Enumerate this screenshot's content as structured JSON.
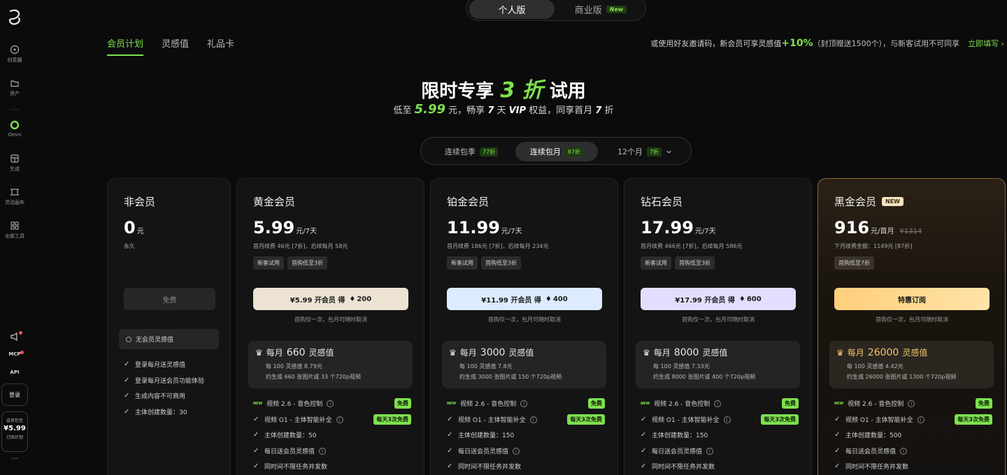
{
  "sidebar": {
    "items": [
      {
        "label": "创意圈",
        "icon": "compass-icon"
      },
      {
        "label": "资产",
        "icon": "folder-icon"
      },
      {
        "label": "Omni",
        "icon": "omni-icon"
      },
      {
        "label": "生成",
        "icon": "generate-icon"
      },
      {
        "label": "灵动画布",
        "icon": "canvas-icon"
      },
      {
        "label": "全部工具",
        "icon": "grid-icon"
      }
    ],
    "mcp": "MCP",
    "api": "API",
    "login": "登录",
    "promo": {
      "line1": "会员包至",
      "price": "¥5.99",
      "line3": "订阅计划"
    },
    "more": "···"
  },
  "top_switch": {
    "personal": "个人版",
    "business": "商业版",
    "new_label": "New"
  },
  "tabs": [
    "会员计划",
    "灵感值",
    "礼品卡"
  ],
  "invite": {
    "text1": "或使用好友邀请码，新会员可享灵感值",
    "bonus": "+10%",
    "text2": "（封顶赠送1500个），与新客试用不可同享",
    "link": "立即填写 ›"
  },
  "hero": {
    "title_pre": "限时专享 ",
    "title_num": "3 折",
    "title_post": " 试用",
    "sub_1": "低至 ",
    "sub_price": "5.99",
    "sub_2": " 元，畅享 ",
    "sub_days": "7",
    "sub_3": " 天 ",
    "sub_vip": "VIP",
    "sub_4": " 权益，同享首月 ",
    "sub_discount": "7",
    "sub_5": " 折"
  },
  "billing": [
    {
      "label": "连续包季",
      "discount": "77折",
      "active": false
    },
    {
      "label": "连续包月",
      "discount": "87折",
      "active": true
    },
    {
      "label": "12个月",
      "discount": "7折",
      "active": false
    }
  ],
  "plans": {
    "free": {
      "name": "非会员",
      "price": "0",
      "unit": "元",
      "period": "永久",
      "cta": "免费",
      "no_credit": "无会员灵感值",
      "features": [
        "登录每月送灵感值",
        "登录每月送会员功能体验",
        "生成内容不可商用",
        "主体创建数量：30"
      ]
    },
    "gold": {
      "name": "黄金会员",
      "price": "5.99",
      "unit": "元/7天",
      "renew": "首月续费 46元 [7折]，后续每月 58元",
      "tags": [
        "新客试用",
        "首购低至3折"
      ],
      "cta_pre": "¥5.99 开会员  得",
      "cta_num": "200",
      "note": "首购仅一次，包月可随时取消",
      "credits_pre": "每月",
      "credits_num": "660",
      "credits_post": "灵感值",
      "credits_l2": "每 100 灵感值 8.79元",
      "credits_l3": "约生成 660 张图片或 33 个720p视频",
      "features": [
        "视频 2.6 - 音色控制",
        "视频 O1 - 主体智能补全",
        "主体创建数量：50",
        "每日送会员灵感值",
        "同时间不限任务并发数"
      ],
      "badges": [
        "免费",
        "每天3次免费"
      ]
    },
    "platinum": {
      "name": "铂金会员",
      "price": "11.99",
      "unit": "元/7天",
      "renew": "首月续费 186元 [7折]，后续每月 234元",
      "tags": [
        "新客试用",
        "首购低至3折"
      ],
      "cta_pre": "¥11.99 开会员  得",
      "cta_num": "400",
      "note": "首购仅一次，包月可随时取消",
      "credits_pre": "每月",
      "credits_num": "3000",
      "credits_post": "灵感值",
      "credits_l2": "每 100 灵感值 7.8元",
      "credits_l3": "约生成 3000 张图片或 150 个720p视频",
      "features": [
        "视频 2.6 - 音色控制",
        "视频 O1 - 主体智能补全",
        "主体创建数量：150",
        "每日送会员灵感值",
        "同时间不限任务并发数"
      ],
      "badges": [
        "免费",
        "每天3次免费"
      ]
    },
    "diamond": {
      "name": "钻石会员",
      "price": "17.99",
      "unit": "元/7天",
      "renew": "首月续费 466元 [7折]，后续每月 586元",
      "tags": [
        "新客试用",
        "首购低至3折"
      ],
      "cta_pre": "¥17.99 开会员  得",
      "cta_num": "600",
      "note": "首购仅一次，包月可随时取消",
      "credits_pre": "每月",
      "credits_num": "8000",
      "credits_post": "灵感值",
      "credits_l2": "每 100 灵感值 7.33元",
      "credits_l3": "约生成 8000 张图片或 400 个720p视频",
      "features": [
        "视频 2.6 - 音色控制",
        "视频 O1 - 主体智能补全",
        "主体创建数量：150",
        "每日送会员灵感值",
        "同时间不限任务并发数"
      ],
      "badges": [
        "免费",
        "每天3次免费"
      ]
    },
    "black": {
      "name": "黑金会员",
      "new_tag": "NEW",
      "price": "916",
      "unit": "元/首月",
      "strike": "¥1314",
      "renew": "下月续费金额：1149元 [87折]",
      "tags": [
        "首购低至7折"
      ],
      "cta": "特惠订阅",
      "note": "首购仅一次，包月可随时取消",
      "credits_pre": "每月",
      "credits_num": "26000",
      "credits_post": "灵感值",
      "credits_l2": "每 100 灵感值 4.42元",
      "credits_l3": "约生成 26000 张图片或 1300 个720p视频",
      "features": [
        "视频 2.6 - 音色控制",
        "视频 O1 - 主体智能补全",
        "主体创建数量：500",
        "每日送会员灵感值",
        "同时间不限任务并发数"
      ],
      "badges": [
        "免费",
        "每天3次免费"
      ]
    }
  },
  "colors": {
    "accent": "#7ee04f",
    "background": "#0b0b0c",
    "card": "#141415",
    "gold_cta": "#ece3d2",
    "platinum_cta": "#dcebff",
    "diamond_cta": "#e4ddff",
    "black_cta": "#ffcf7a"
  }
}
